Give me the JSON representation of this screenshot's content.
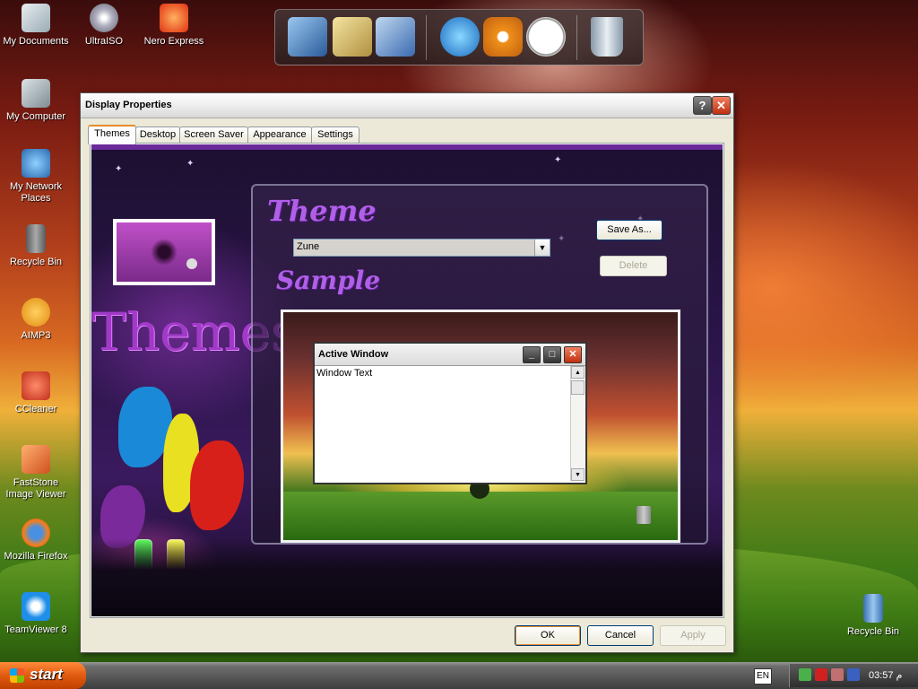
{
  "desktop": {
    "icons_left": [
      {
        "label": "My Documents",
        "icon": "folder-documents-icon",
        "color": "#cfd8dc"
      },
      {
        "label": "My Computer",
        "icon": "computer-icon",
        "color": "#b0bec5"
      },
      {
        "label": "My Network Places",
        "icon": "network-places-icon",
        "color": "#4fa3e0"
      },
      {
        "label": "Recycle Bin",
        "icon": "recycle-bin-icon",
        "color": "#8d8d8d"
      },
      {
        "label": "AIMP3",
        "icon": "aimp-icon",
        "color": "#f29b1d"
      },
      {
        "label": "CCleaner",
        "icon": "ccleaner-icon",
        "color": "#d64a2a"
      },
      {
        "label": "FastStone Image Viewer",
        "icon": "faststone-icon",
        "color": "#e0703a"
      },
      {
        "label": "Mozilla Firefox",
        "icon": "firefox-icon",
        "color": "#e66000"
      },
      {
        "label": "TeamViewer 8",
        "icon": "teamviewer-icon",
        "color": "#0e8ee9"
      }
    ],
    "icons_top": [
      {
        "label": "UltraISO",
        "icon": "ultraiso-disc-icon",
        "color": "#9e9ea8"
      },
      {
        "label": "Nero Express",
        "icon": "nero-express-icon",
        "color": "#e84820"
      }
    ],
    "icon_right": {
      "label": "Recycle Bin",
      "icon": "recycle-bin-icon",
      "color": "#5aa0e0"
    }
  },
  "dock": {
    "items": [
      {
        "name": "computer-icon",
        "color": "#4a7ac0"
      },
      {
        "name": "folder-icon",
        "color": "#d8c070"
      },
      {
        "name": "control-panel-icon",
        "color": "#5a8ad0"
      },
      {
        "name": "internet-globe-icon",
        "color": "#3a9ad8"
      },
      {
        "name": "media-player-icon",
        "color": "#f0901a"
      },
      {
        "name": "clock-icon",
        "color": "#f4f4f4"
      },
      {
        "name": "trash-can-icon",
        "color": "#c8d0d8"
      }
    ]
  },
  "dialog": {
    "title": "Display Properties",
    "help_glyph": "?",
    "close_glyph": "✕",
    "tabs": [
      "Themes",
      "Desktop",
      "Screen Saver",
      "Appearance",
      "Settings"
    ],
    "active_tab": "Themes",
    "themes_tab": {
      "big_title": "Themes",
      "theme_heading": "Theme",
      "sample_heading": "Sample",
      "theme_selected": "Zune",
      "save_as_label": "Save As...",
      "delete_label": "Delete"
    },
    "preview": {
      "window_title": "Active Window",
      "window_text": "Window Text"
    },
    "buttons": {
      "ok": "OK",
      "cancel": "Cancel",
      "apply": "Apply"
    }
  },
  "taskbar": {
    "start_label": "start",
    "language": "EN",
    "clock": "03:57 م",
    "accent_colors": {
      "start": "#e05a10",
      "bar": "#555555"
    }
  }
}
